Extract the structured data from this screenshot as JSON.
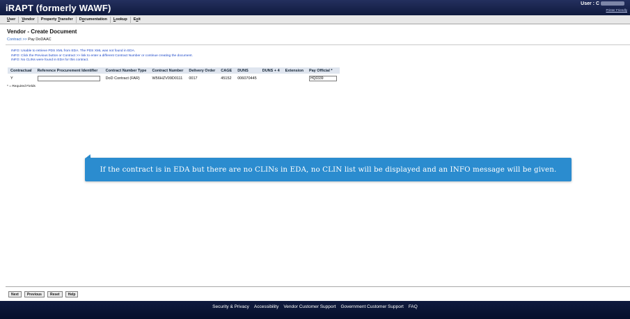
{
  "header": {
    "app_title": "iRAPT (formerly WAWF)",
    "user_label": "User : C",
    "printer_link": "Printer Friendly"
  },
  "menu": {
    "items": [
      {
        "pre": "",
        "ul": "U",
        "post": "ser"
      },
      {
        "pre": "",
        "ul": "V",
        "post": "endor"
      },
      {
        "pre": "Property ",
        "ul": "T",
        "post": "ransfer"
      },
      {
        "pre": "D",
        "ul": "o",
        "post": "cumentation"
      },
      {
        "pre": "",
        "ul": "L",
        "post": "ookup"
      },
      {
        "pre": "E",
        "ul": "x",
        "post": "it"
      }
    ]
  },
  "page": {
    "title": "Vendor - Create Document",
    "breadcrumb_link": "Contract",
    "breadcrumb_sep": ">>",
    "breadcrumb_current": "Pay DoDAAC"
  },
  "info_messages": [
    "INFO: Unable to retrieve PDS XML from EDA. The PDS XML was not found in EDA.",
    "INFO: Click the Previous button or Contract >> link to enter a different Contract Number or continue creating the document.",
    "INFO: No CLINs were found in EDA for this contract."
  ],
  "table": {
    "headers": [
      "Contractual",
      "Reference Procurement Identifier",
      "Contract Number Type",
      "Contract Number",
      "Delivery Order",
      "CAGE",
      "DUNS",
      "DUNS + 4",
      "Extension",
      "Pay Official *"
    ],
    "row": {
      "contractual": "Y",
      "ref_proc_id": "",
      "contract_type": "DoD Contract (FAR)",
      "contract_number": "W56HZV09D0111",
      "delivery_order": "0017",
      "cage": "45152",
      "duns": "006070445",
      "duns4": "",
      "extension": "",
      "pay_official": "HQ0339"
    }
  },
  "required_note": "* = Required Fields",
  "tooltip": {
    "text": "If the contract is in EDA but there are no CLINs in EDA, no CLIN list will be displayed and an INFO message will be given."
  },
  "buttons": {
    "next": "Next",
    "previous": "Previous",
    "reset": "Reset",
    "help": "Help"
  },
  "footer": {
    "links": [
      "Security & Privacy",
      "Accessibility",
      "Vendor Customer Support",
      "Government Customer Support",
      "FAQ"
    ]
  },
  "colors": {
    "header_bg": "#1a2550",
    "info_text": "#1a46c8",
    "tooltip_bg": "#2b8ccf",
    "table_header_bg": "#dfe5ef"
  }
}
